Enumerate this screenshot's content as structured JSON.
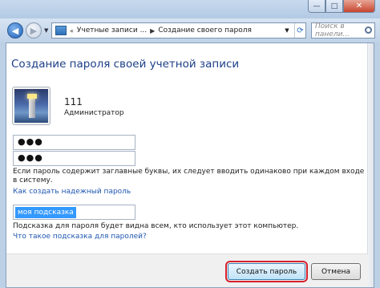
{
  "navigation": {
    "breadcrumb_1": "Учетные записи ...",
    "breadcrumb_2": "Создание своего пароля",
    "search_placeholder": "Поиск в панели..."
  },
  "window_buttons": {
    "minimize": "—",
    "maximize": "□",
    "close": "✕"
  },
  "page": {
    "heading": "Создание пароля своей учетной записи"
  },
  "user": {
    "name": "111",
    "role": "Администратор"
  },
  "form": {
    "password": "●●●",
    "password_confirm": "●●●",
    "password_note": "Если пароль содержит заглавные буквы, их следует вводить одинаково при каждом входе в систему.",
    "strong_password_link": "Как создать надежный пароль",
    "hint_value": "моя подсказка",
    "hint_note": "Подсказка для пароля будет видна всем, кто использует этот компьютер.",
    "hint_link": "Что такое подсказка для паролей?"
  },
  "buttons": {
    "create": "Создать пароль",
    "cancel": "Отмена"
  },
  "icons": {
    "back": "back-arrow-icon",
    "forward": "forward-arrow-icon",
    "refresh": "refresh-icon",
    "search": "search-icon",
    "user": "lighthouse-user-picture"
  },
  "colors": {
    "heading": "#1c3f87",
    "link": "#1f56b0",
    "highlight": "#d8212c",
    "selection": "#3399ff"
  }
}
